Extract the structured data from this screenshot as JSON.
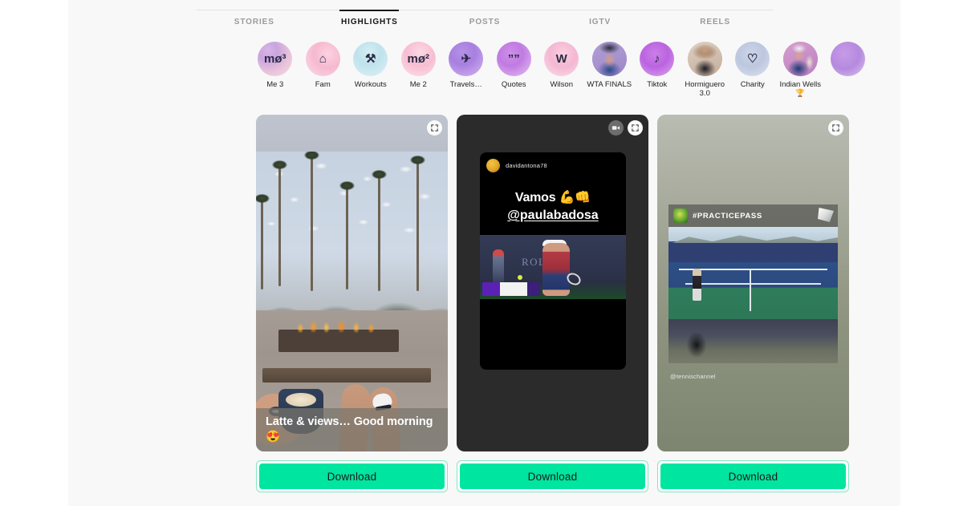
{
  "tabs": [
    {
      "label": "STORIES",
      "active": false
    },
    {
      "label": "HIGHLIGHTS",
      "active": true
    },
    {
      "label": "POSTS",
      "active": false
    },
    {
      "label": "IGTV",
      "active": false
    },
    {
      "label": "REELS",
      "active": false
    }
  ],
  "highlights": [
    {
      "label": "Me 3",
      "glyph": "mø³",
      "theme": "g-me3"
    },
    {
      "label": "Fam",
      "glyph": "⌂",
      "theme": "g-fam"
    },
    {
      "label": "Workouts",
      "glyph": "⚒",
      "theme": "g-work"
    },
    {
      "label": "Me 2",
      "glyph": "mø²",
      "theme": "g-me2"
    },
    {
      "label": "Travels…",
      "glyph": "✈",
      "theme": "g-trav"
    },
    {
      "label": "Quotes",
      "glyph": "””",
      "theme": "g-quot"
    },
    {
      "label": "Wilson",
      "glyph": "W",
      "theme": "g-wils"
    },
    {
      "label": "WTA FINALS",
      "glyph": "",
      "theme": "g-wta"
    },
    {
      "label": "Tiktok",
      "glyph": "♪",
      "theme": "g-tikt"
    },
    {
      "label": "Hormiguero 3.0",
      "glyph": "",
      "theme": "g-horm"
    },
    {
      "label": "Charity",
      "glyph": "♡",
      "theme": "g-char"
    },
    {
      "label": "Indian Wells 🏆",
      "glyph": "",
      "theme": "g-indw"
    },
    {
      "label": "",
      "glyph": "",
      "theme": "g-more"
    }
  ],
  "cards": [
    {
      "id": "card-latte",
      "caption": "Latte & views… Good morning 😍",
      "download_label": "Download",
      "has_video_icon": false
    },
    {
      "id": "card-vamos",
      "username": "davidantona78",
      "line1": "Vamos 💪👊",
      "line2": "@paulabadosa",
      "video_watermark": "ROLEX",
      "download_label": "Download",
      "has_video_icon": true
    },
    {
      "id": "card-practicepass",
      "hashtag": "#PRACTICEPASS",
      "handle": "@tennischannel",
      "download_label": "Download",
      "has_video_icon": false
    }
  ],
  "colors": {
    "accent_green": "#00e5a0",
    "accent_green_border": "#7fe8c0",
    "page_bg": "#f8f8f8",
    "tab_active": "#141414",
    "tab_inactive": "#9a9a9a"
  }
}
